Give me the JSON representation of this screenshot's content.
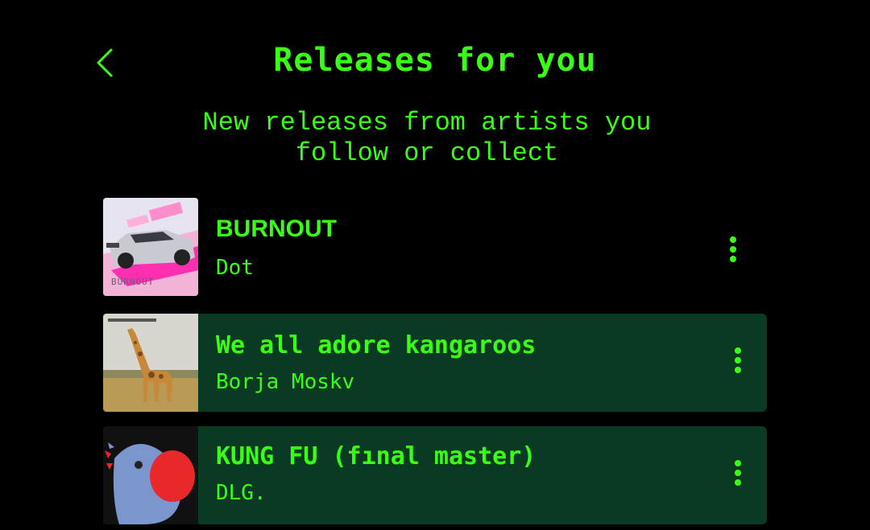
{
  "header": {
    "back_icon": "chevron-left-icon",
    "title": "Releases for you",
    "subtitle": "New releases from artists you\nfollow or collect"
  },
  "colors": {
    "background": "#000000",
    "accent": "#39ff14",
    "row_highlight": "#0b3a24"
  },
  "releases": [
    {
      "title": "BURNOUT",
      "artist": "Dot",
      "cover_icon": "car-cover-art",
      "cover_text": "BURNOUT",
      "more_icon": "more-vertical-icon"
    },
    {
      "title": "We all adore kangaroos",
      "artist": "Borja Moskv",
      "cover_icon": "giraffe-cover-art",
      "more_icon": "more-vertical-icon"
    },
    {
      "title": "KUNG FU (fınal master)",
      "artist": "DLG.",
      "cover_icon": "bird-cover-art",
      "more_icon": "more-vertical-icon"
    }
  ]
}
